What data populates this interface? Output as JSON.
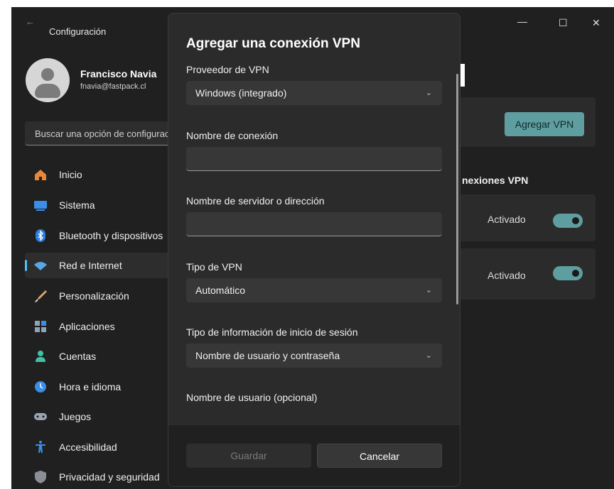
{
  "window": {
    "title": "Configuración",
    "back_glyph": "←",
    "minimize_glyph": "—",
    "maximize_glyph": "☐",
    "close_glyph": "✕"
  },
  "profile": {
    "name": "Francisco Navia",
    "email": "fnavia@fastpack.cl"
  },
  "search": {
    "placeholder": "Buscar una opción de configuración"
  },
  "sidebar": {
    "items": [
      {
        "label": "Inicio",
        "icon": "home-icon",
        "color": "#e8873a"
      },
      {
        "label": "Sistema",
        "icon": "system-icon",
        "color": "#3a8ee6"
      },
      {
        "label": "Bluetooth y dispositivos",
        "icon": "bluetooth-icon",
        "color": "#2b7de0"
      },
      {
        "label": "Red e Internet",
        "icon": "network-icon",
        "color": "#5aa7e6",
        "active": true
      },
      {
        "label": "Personalización",
        "icon": "brush-icon",
        "color": "#e0a56a"
      },
      {
        "label": "Aplicaciones",
        "icon": "apps-icon",
        "color": "#8ea3b8"
      },
      {
        "label": "Cuentas",
        "icon": "accounts-icon",
        "color": "#3fc3a2"
      },
      {
        "label": "Hora e idioma",
        "icon": "time-language-icon",
        "color": "#3a8ee6"
      },
      {
        "label": "Juegos",
        "icon": "gamepad-icon",
        "color": "#9aa6b2"
      },
      {
        "label": "Accesibilidad",
        "icon": "accessibility-icon",
        "color": "#3a8ee6"
      },
      {
        "label": "Privacidad y seguridad",
        "icon": "shield-icon",
        "color": "#8a8f96"
      }
    ]
  },
  "background": {
    "add_vpn_button": "Agregar VPN",
    "section_label": "nexiones VPN",
    "rows": [
      {
        "status": "Activado"
      },
      {
        "status": "Activado"
      }
    ]
  },
  "dialog": {
    "title": "Agregar una conexión VPN",
    "provider_label": "Proveedor de VPN",
    "provider_value": "Windows (integrado)",
    "connection_name_label": "Nombre de conexión",
    "connection_name_value": "",
    "server_label": "Nombre de servidor o dirección",
    "server_value": "",
    "vpn_type_label": "Tipo de VPN",
    "vpn_type_value": "Automático",
    "signin_type_label": "Tipo de información de inicio de sesión",
    "signin_type_value": "Nombre de usuario y contraseña",
    "username_label": "Nombre de usuario (opcional)",
    "save_button": "Guardar",
    "cancel_button": "Cancelar"
  }
}
